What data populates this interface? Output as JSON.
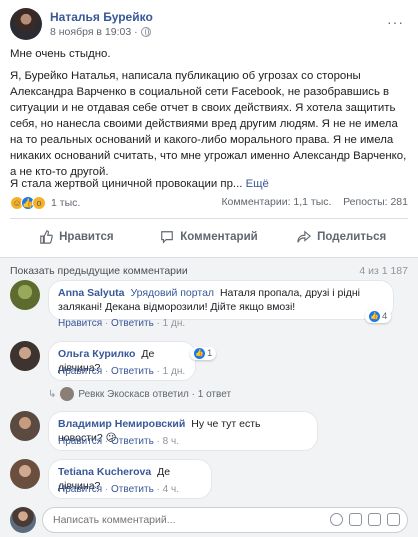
{
  "post": {
    "author": "Наталья Бурейко",
    "date": "8 ноября в 19:03 · ",
    "paragraph1": "Мне очень стыдно.",
    "paragraph2": "Я, Бурейко Наталья, написала публикацию об угрозах со стороны Александра Варченко в социальной сети Facebook, не разобравшись в ситуации и не отдавая себе отчет в своих действиях. Я хотела защитить себя, но нанесла своими действиями вред другим людям. Я не не имела на то реальных оснований и какого-либо морального права. Я не имела никаких оснований считать, что мне угрожал именно Александр Варченко, а не кто-то другой.",
    "paragraph3": "Я стала жертвой циничной провокации пр...",
    "more_label": "Ещё",
    "reactions_count": "1 тыс.",
    "comments_count": "Комментарии: 1,1 тыс.",
    "shares_count": "Репосты: 281"
  },
  "actions": {
    "like": "Нравится",
    "comment": "Комментарий",
    "share": "Поделиться"
  },
  "comments_section": {
    "show_previous": "Показать предыдущие комментарии",
    "counter": "4 из 1 187",
    "items": [
      {
        "name": "Anna Salyuta",
        "page": "Урядовий портал",
        "text": "Наталя пропала, друзі і рідні залякані! Декана відморозили! Дійте якщо вмозі!",
        "like": "Нравится",
        "reply": "Ответить",
        "time": "1 дн.",
        "likes": "4"
      },
      {
        "name": "Ольга Курилко",
        "text": "Де дівчина?",
        "like": "Нравится",
        "reply": "Ответить",
        "time": "1 дн.",
        "likes": "1"
      },
      {
        "name": "Владимир Немировский",
        "text": "Ну че тут есть новости?",
        "like": "Нравится",
        "reply": "Ответить",
        "time": "8 ч."
      },
      {
        "name": "Tetiana Kucherova",
        "text": "Де дівчина?",
        "like": "Нравится",
        "reply": "Ответить",
        "time": "4 ч."
      }
    ],
    "replied": "Ревкк Экоскасв ответил · 1 ответ",
    "write_placeholder": "Написать комментарий..."
  }
}
